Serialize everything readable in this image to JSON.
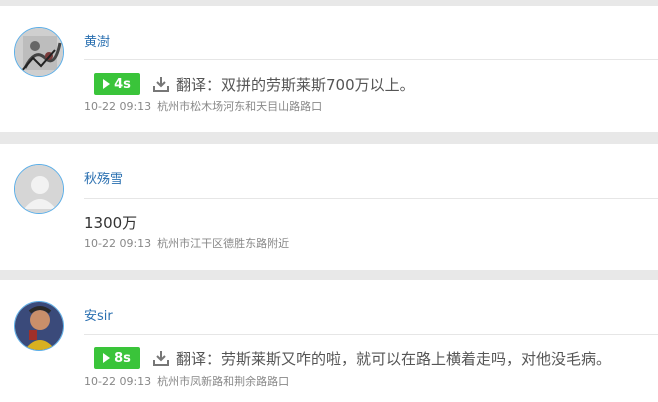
{
  "posts": [
    {
      "username": "黄澍",
      "audio_duration": "4s",
      "translation": "翻译：双拼的劳斯莱斯700万以上。",
      "time": "10-22 09:13",
      "location": "杭州市松木场河东和天目山路路口"
    },
    {
      "username": "秋殇雪",
      "text": "1300万",
      "time": "10-22 09:13",
      "location": "杭州市江干区德胜东路附近"
    },
    {
      "username": "安sir",
      "audio_duration": "8s",
      "translation": "翻译：劳斯莱斯又咋的啦，就可以在路上横着走吗，对他没毛病。",
      "time": "10-22 09:13",
      "location": "杭州市凤新路和荆余路路口"
    }
  ],
  "colors": {
    "username": "#2a6fb0",
    "play_button": "#3ac43a",
    "avatar_border": "#5aaee8"
  }
}
